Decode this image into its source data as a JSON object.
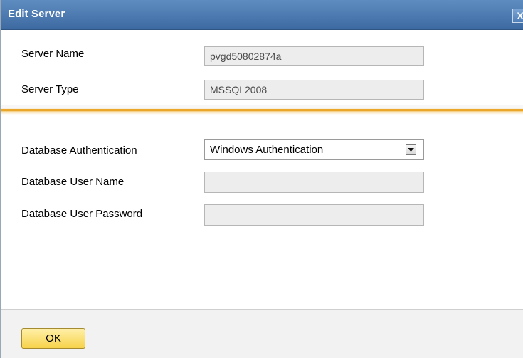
{
  "dialog": {
    "title": "Edit Server",
    "close_label": "X"
  },
  "server": {
    "name_label": "Server Name",
    "name_value": "pvgd50802874a",
    "type_label": "Server Type",
    "type_value": "MSSQL2008"
  },
  "database": {
    "auth_label": "Database Authentication",
    "auth_value": "Windows Authentication",
    "user_label": "Database User Name",
    "user_value": "",
    "password_label": "Database User Password",
    "password_value": ""
  },
  "footer": {
    "ok_label": "OK"
  },
  "icons": {
    "close": "close-icon",
    "dropdown": "chevron-down-icon"
  },
  "colors": {
    "titlebar": "#4a78b0",
    "separator_accent": "#e9a423",
    "ok_button": "#f7d24a",
    "field_background": "#ededed"
  }
}
